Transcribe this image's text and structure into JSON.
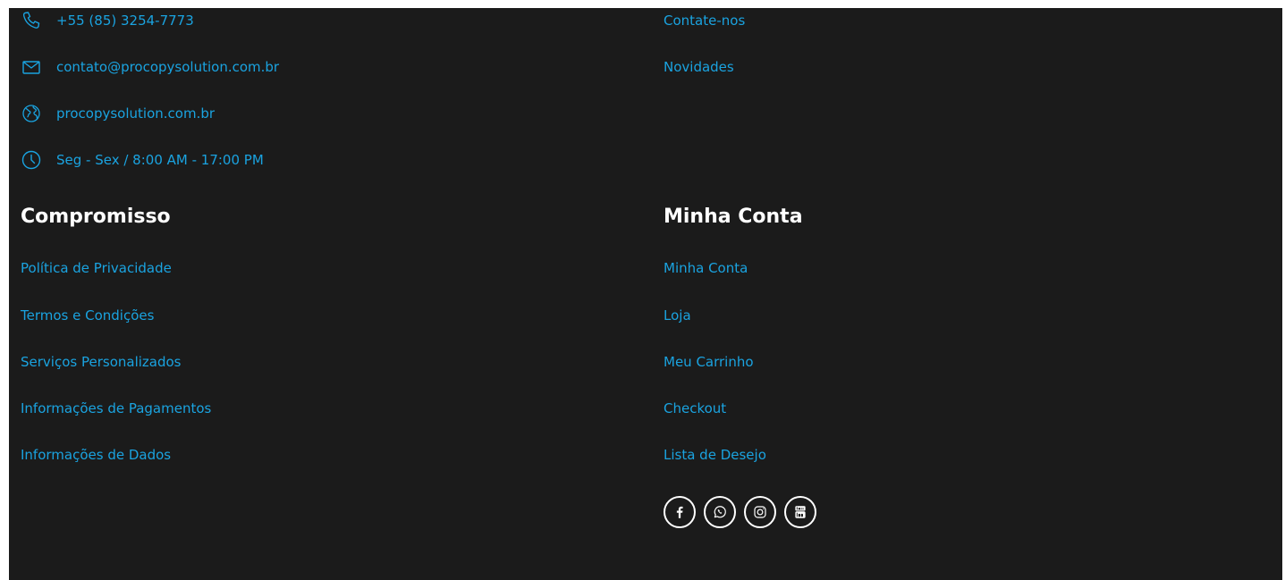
{
  "contact": {
    "phone": {
      "icon": "phone-icon",
      "text": "+55 (85) 3254-7773"
    },
    "email": {
      "icon": "mail-icon",
      "text": "contato@procopysolution.com.br"
    },
    "website": {
      "icon": "globe-icon",
      "text": "procopysolution.com.br"
    },
    "hours": {
      "icon": "clock-icon",
      "text": "Seg - Sex / 8:00 AM - 17:00 PM"
    }
  },
  "top_right_links": [
    "Contate-nos",
    "Novidades"
  ],
  "compromisso": {
    "title": "Compromisso",
    "links": [
      "Política de Privacidade",
      "Termos e Condições",
      "Serviços Personalizados",
      "Informações de Pagamentos",
      "Informações de Dados"
    ]
  },
  "minha_conta": {
    "title": "Minha Conta",
    "links": [
      "Minha Conta",
      "Loja",
      "Meu Carrinho",
      "Checkout",
      "Lista de Desejo"
    ]
  },
  "socials": [
    "facebook-icon",
    "whatsapp-icon",
    "instagram-icon",
    "youtube-icon"
  ],
  "colors": {
    "background": "#1b1b1b",
    "link": "#1aa3e0",
    "heading": "#ffffff"
  }
}
